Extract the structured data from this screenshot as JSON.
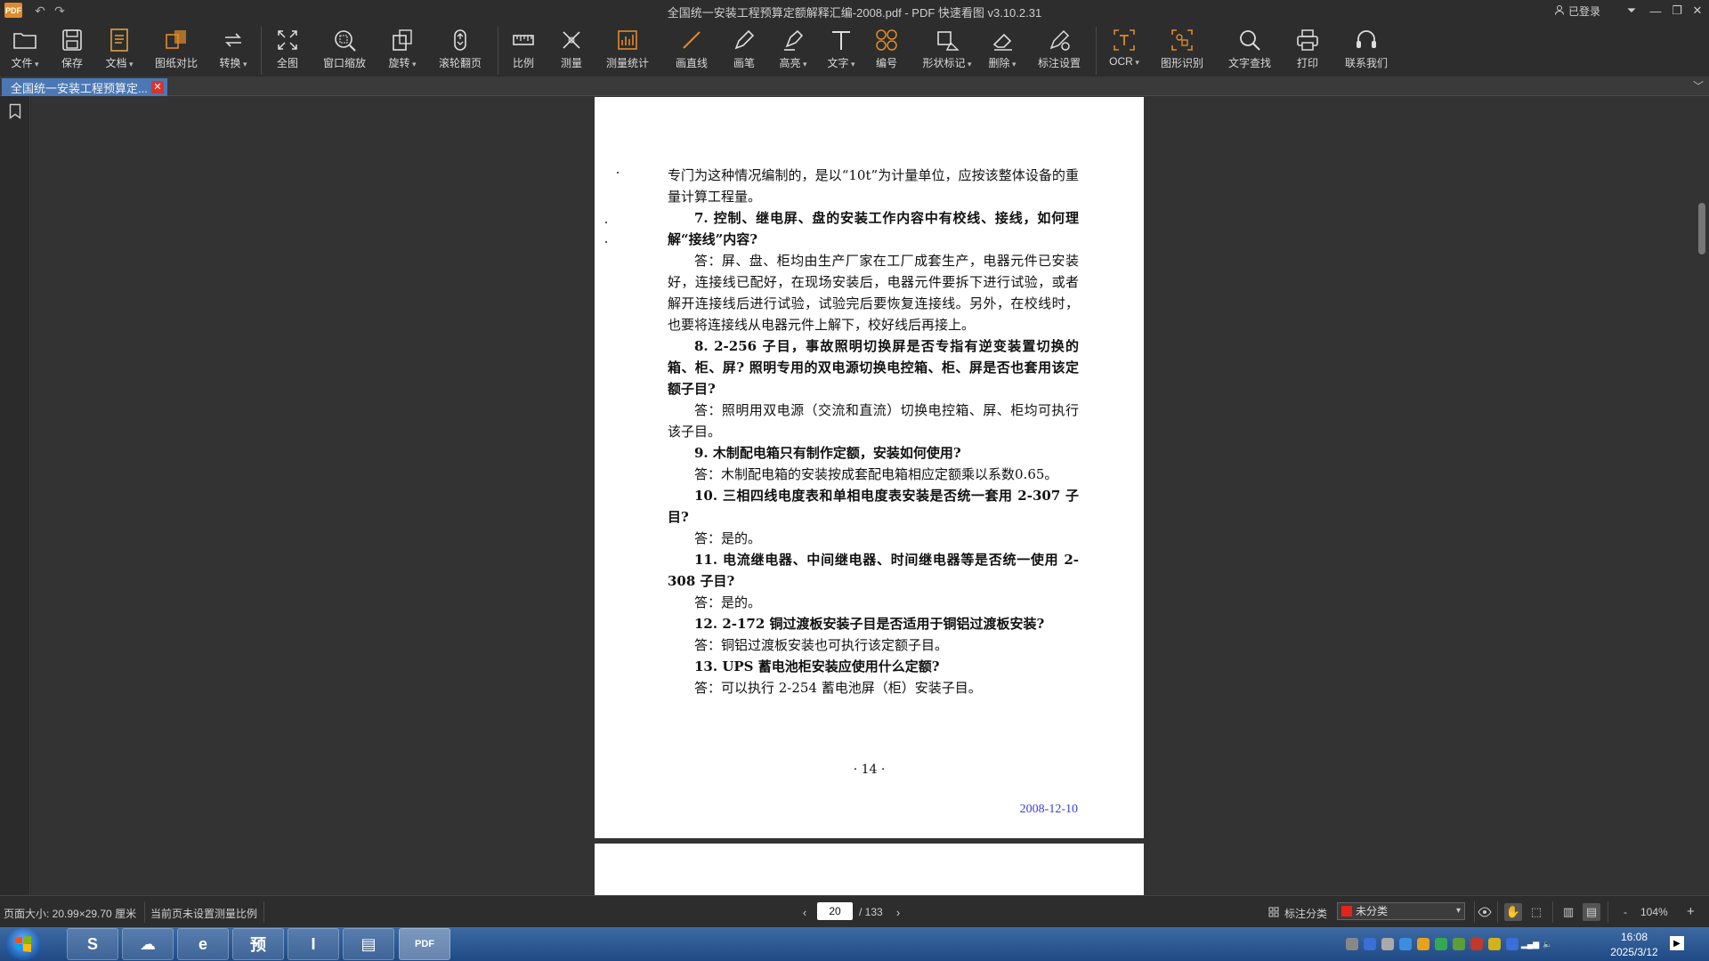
{
  "app": {
    "title": "全国统一安装工程预算定额解释汇编-2008.pdf - PDF 快速看图 v3.10.2.31",
    "logo_text": "PDF",
    "login_label": "已登录",
    "accent_color": "#e08b2a"
  },
  "toolbar": {
    "items": [
      {
        "label": "文件",
        "icon": "folder-icon"
      },
      {
        "label": "保存",
        "icon": "save-icon"
      },
      {
        "label": "文档",
        "icon": "document-icon"
      },
      {
        "label": "图纸对比",
        "icon": "compare-icon"
      },
      {
        "label": "转换",
        "icon": "convert-icon"
      },
      {
        "label": "全图",
        "icon": "fit-all-icon"
      },
      {
        "label": "窗口缩放",
        "icon": "zoom-window-icon"
      },
      {
        "label": "旋转",
        "icon": "rotate-icon"
      },
      {
        "label": "滚轮翻页",
        "icon": "mouse-wheel-icon"
      },
      {
        "label": "比例",
        "icon": "scale-icon"
      },
      {
        "label": "测量",
        "icon": "measure-icon"
      },
      {
        "label": "测量统计",
        "icon": "measure-stats-icon"
      },
      {
        "label": "画直线",
        "icon": "line-icon"
      },
      {
        "label": "画笔",
        "icon": "pen-icon"
      },
      {
        "label": "高亮",
        "icon": "highlighter-icon"
      },
      {
        "label": "文字",
        "icon": "text-icon"
      },
      {
        "label": "编号",
        "icon": "numbering-icon"
      },
      {
        "label": "形状标记",
        "icon": "shape-mark-icon"
      },
      {
        "label": "删除",
        "icon": "eraser-icon"
      },
      {
        "label": "标注设置",
        "icon": "annotation-settings-icon"
      },
      {
        "label": "OCR",
        "icon": "ocr-icon"
      },
      {
        "label": "图形识别",
        "icon": "shape-recognition-icon"
      },
      {
        "label": "文字查找",
        "icon": "search-icon"
      },
      {
        "label": "打印",
        "icon": "print-icon"
      },
      {
        "label": "联系我们",
        "icon": "headset-icon"
      }
    ]
  },
  "tab": {
    "label": "全国统一安装工程预算定...",
    "close": "✕"
  },
  "document": {
    "paragraphs": [
      {
        "type": "a",
        "text": "专门为这种情况编制的，是以“10t”为计量单位，应按该整体设备的重量计算工程量。"
      },
      {
        "type": "q",
        "text": "7. 控制、继电屏、盘的安装工作内容中有校线、接线，如何理解“接线”内容?"
      },
      {
        "type": "a",
        "text": "答：屏、盘、柜均由生产厂家在工厂成套生产，电器元件已安装好，连接线已配好，在现场安装后，电器元件要拆下进行试验，或者解开连接线后进行试验，试验完后要恢复连接线。另外，在校线时，也要将连接线从电器元件上解下，校好线后再接上。"
      },
      {
        "type": "q",
        "text": "8. 2-256 子目，事故照明切换屏是否专指有逆变装置切换的箱、柜、屏? 照明专用的双电源切换电控箱、柜、屏是否也套用该定额子目?"
      },
      {
        "type": "a",
        "text": "答：照明用双电源（交流和直流）切换电控箱、屏、柜均可执行该子目。"
      },
      {
        "type": "q",
        "text": "9. 木制配电箱只有制作定额，安装如何使用?"
      },
      {
        "type": "a",
        "text": "答：木制配电箱的安装按成套配电箱相应定额乘以系数0.65。"
      },
      {
        "type": "q",
        "text": "10. 三相四线电度表和单相电度表安装是否统一套用 2-307 子目?"
      },
      {
        "type": "a",
        "text": "答：是的。"
      },
      {
        "type": "q",
        "text": "11. 电流继电器、中间继电器、时间继电器等是否统一使用 2-308 子目?"
      },
      {
        "type": "a",
        "text": "答：是的。"
      },
      {
        "type": "q",
        "text": "12. 2-172 铜过渡板安装子目是否适用于铜铝过渡板安装?"
      },
      {
        "type": "a",
        "text": "答：铜铝过渡板安装也可执行该定额子目。"
      },
      {
        "type": "q",
        "text": "13. UPS 蓄电池柜安装应使用什么定额?"
      },
      {
        "type": "a",
        "text": "答：可以执行 2-254 蓄电池屏（柜）安装子目。"
      }
    ],
    "page_footer": "· 14 ·",
    "stamp_date": "2008-12-10"
  },
  "status": {
    "page_size": "页面大小: 20.99×29.70 厘米",
    "scale_note": "当前页未设置测量比例",
    "current_page": "20",
    "total_pages": "/ 133",
    "annot_category_label": "标注分类",
    "category_value": "未分类",
    "category_color": "#e3231c",
    "zoom": "104%",
    "zoom_minus": "-",
    "zoom_plus": "+"
  },
  "taskbar": {
    "apps": [
      {
        "name": "browser-360-icon",
        "text": "S"
      },
      {
        "name": "cloud-drive-icon",
        "text": "☁"
      },
      {
        "name": "ie-browser-icon",
        "text": "e"
      },
      {
        "name": "budget-app-icon",
        "text": "预"
      },
      {
        "name": "input-app-icon",
        "text": "I"
      },
      {
        "name": "file-explorer-icon",
        "text": "▤"
      },
      {
        "name": "pdf-viewer-icon",
        "text": "PDF"
      }
    ],
    "time": "16:08",
    "date": "2025/3/12"
  }
}
